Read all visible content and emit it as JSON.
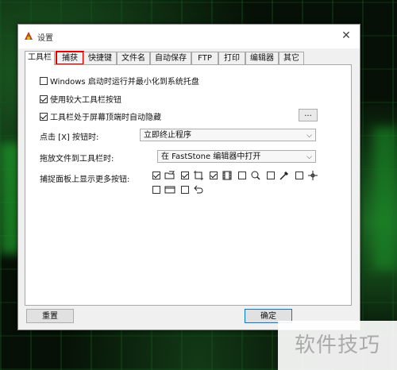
{
  "window": {
    "title": "设置"
  },
  "tabs": [
    {
      "label": "工具栏",
      "active": true
    },
    {
      "label": "捕获",
      "highlighted": true
    },
    {
      "label": "快捷键"
    },
    {
      "label": "文件名"
    },
    {
      "label": "自动保存"
    },
    {
      "label": "FTP"
    },
    {
      "label": "打印"
    },
    {
      "label": "编辑器"
    },
    {
      "label": "其它"
    }
  ],
  "options": {
    "startup_tray": {
      "label": "Windows 启动时运行并最小化到系统托盘",
      "checked": false
    },
    "large_buttons": {
      "label": "使用较大工具栏按钮",
      "checked": true
    },
    "auto_hide": {
      "label": "工具栏处于屏幕顶端时自动隐藏",
      "checked": true
    },
    "ellipsis_label": "..."
  },
  "close_action": {
    "label": "点击 [X] 按钮时:",
    "value": "立即终止程序"
  },
  "drop_action": {
    "label": "拖放文件到工具栏时:",
    "value": "在 FastStone 编辑器中打开"
  },
  "capture_buttons": {
    "label": "捕捉面板上显示更多按钮:",
    "items": [
      {
        "icon": "open-folder-icon",
        "checked": true
      },
      {
        "icon": "rectangle-capture-icon",
        "checked": true
      },
      {
        "icon": "film-icon",
        "checked": true
      },
      {
        "icon": "magnifier-icon",
        "checked": false
      },
      {
        "icon": "color-picker-icon",
        "checked": false
      },
      {
        "icon": "crosshair-icon",
        "checked": false
      },
      {
        "icon": "screen-record-icon",
        "checked": false
      },
      {
        "icon": "undo-arrow-icon",
        "checked": false
      }
    ]
  },
  "footer": {
    "reset": "重置",
    "ok": "确定"
  },
  "watermark": "软件技巧"
}
